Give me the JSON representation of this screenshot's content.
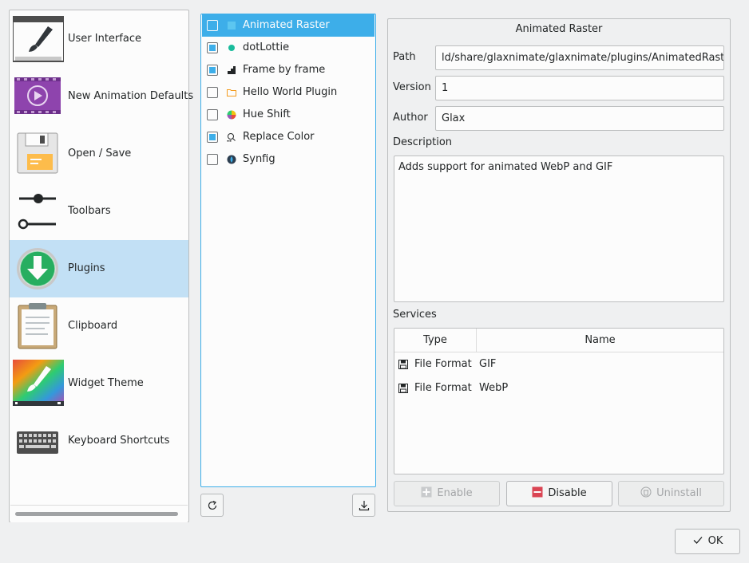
{
  "sidebar": {
    "items": [
      {
        "label": "User Interface",
        "icon": "paintbrush-window-icon"
      },
      {
        "label": "New Animation Defaults",
        "icon": "video-play-icon"
      },
      {
        "label": "Open / Save",
        "icon": "floppy-disk-icon"
      },
      {
        "label": "Toolbars",
        "icon": "sliders-icon"
      },
      {
        "label": "Plugins",
        "icon": "download-arrow-icon",
        "selected": true
      },
      {
        "label": "Clipboard",
        "icon": "clipboard-icon"
      },
      {
        "label": "Widget Theme",
        "icon": "rainbow-brush-icon"
      },
      {
        "label": "Keyboard Shortcuts",
        "icon": "keyboard-icon"
      }
    ]
  },
  "plugins": {
    "items": [
      {
        "label": "Animated Raster",
        "checked": false,
        "selected": true
      },
      {
        "label": "dotLottie",
        "checked": true
      },
      {
        "label": "Frame by frame",
        "checked": true
      },
      {
        "label": "Hello World Plugin",
        "checked": false
      },
      {
        "label": "Hue Shift",
        "checked": false
      },
      {
        "label": "Replace Color",
        "checked": true
      },
      {
        "label": "Synfig",
        "checked": false
      }
    ]
  },
  "details": {
    "title": "Animated Raster",
    "path_label": "Path",
    "path_value": "ld/share/glaxnimate/glaxnimate/plugins/AnimatedRaster",
    "version_label": "Version",
    "version_value": "1",
    "author_label": "Author",
    "author_value": "Glax",
    "description_label": "Description",
    "description_value": "Adds support for animated WebP and GIF",
    "services_label": "Services",
    "services": {
      "columns": [
        "Type",
        "Name"
      ],
      "rows": [
        {
          "type": "File Format",
          "name": "GIF"
        },
        {
          "type": "File Format",
          "name": "WebP"
        }
      ]
    },
    "buttons": {
      "enable": "Enable",
      "disable": "Disable",
      "uninstall": "Uninstall"
    }
  },
  "dialog": {
    "ok_label": "OK"
  },
  "colors": {
    "accent": "#3daee9",
    "selected_sidebar": "#c2e0f5",
    "disable_red": "#da4453"
  }
}
